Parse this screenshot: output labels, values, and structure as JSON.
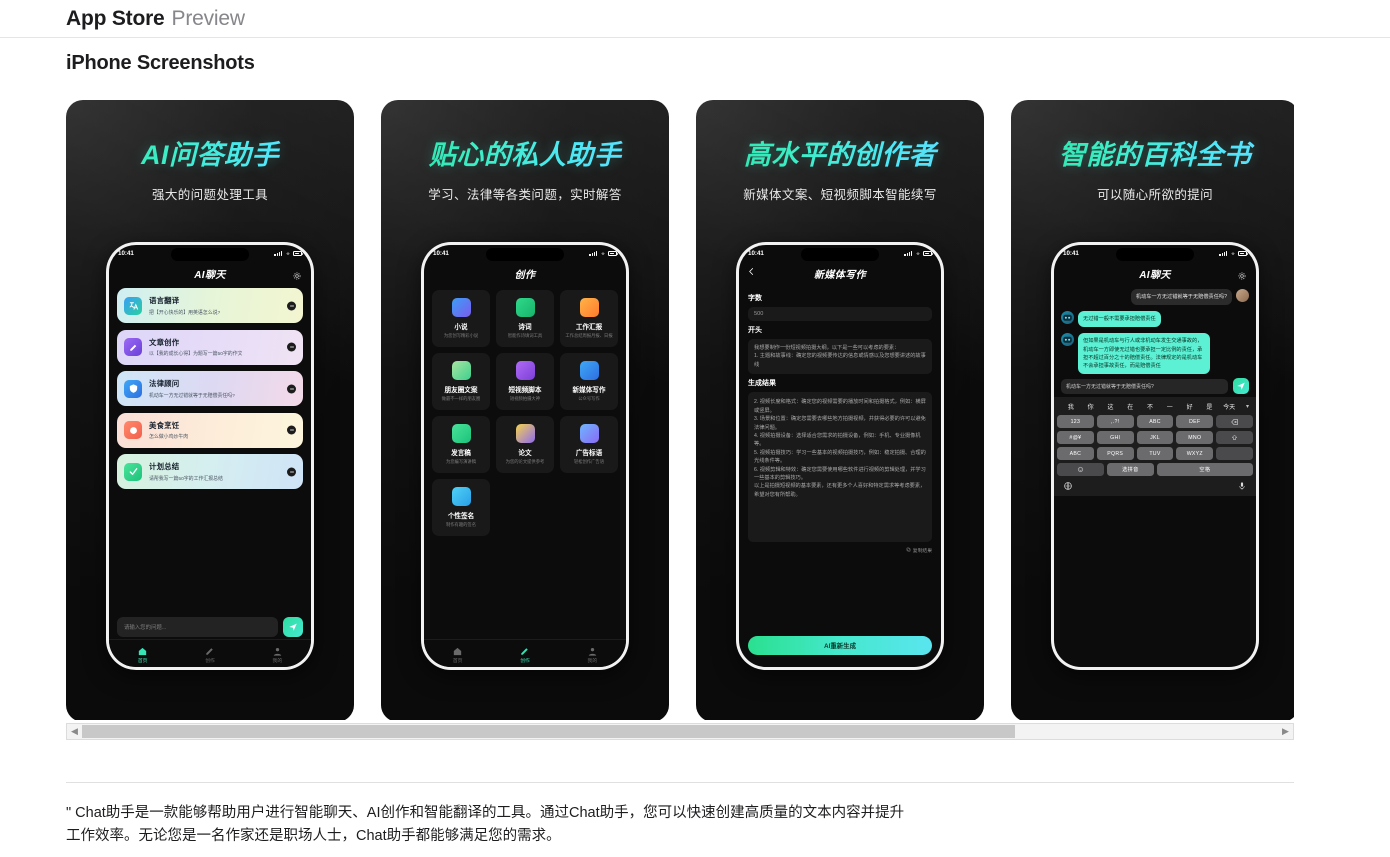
{
  "header": {
    "brand": "App Store",
    "preview": "Preview"
  },
  "section": {
    "title": "iPhone Screenshots"
  },
  "scrollbar": {
    "left_arrow": "◀",
    "right_arrow": "▶"
  },
  "description": "\" Chat助手是一款能够帮助用户进行智能聊天、AI创作和智能翻译的工具。通过Chat助手，您可以快速创建高质量的文本内容并提升工作效率。无论您是一名作家还是职场人士，Chat助手都能够满足您的需求。",
  "colors": {
    "accent_green": "#2fdd9f",
    "accent_cyan": "#5ae5ef",
    "bot_bubble": "#5cf0d5"
  },
  "shots": [
    {
      "title": "AI问答助手",
      "subtitle": "强大的问题处理工具",
      "phone": {
        "status_time": "10:41",
        "nav_title": "AI聊天",
        "nav_right_icon": "gear-icon",
        "cards": [
          {
            "title": "语言翻译",
            "sub": "把【开心快乐的】用英语怎么说?",
            "icon": "translate-icon",
            "bg": "linear-gradient(100deg,#cfeef2,#e6f5d8,#f3f5d0)"
          },
          {
            "title": "文章创作",
            "sub": "以【我的成长心得】为题写一篇50字的作文",
            "icon": "pencil-icon",
            "bg": "linear-gradient(100deg,#ddd6f7,#e6dcf8,#efe3f3)"
          },
          {
            "title": "法律顾问",
            "sub": "机动车一方无过错就等于无赔偿责任吗?",
            "icon": "law-icon",
            "bg": "linear-gradient(100deg,#cfe6f7,#ddd9f3,#f3d9e8)"
          },
          {
            "title": "美食烹饪",
            "sub": "怎么做小鸡炒牛肉",
            "icon": "food-icon",
            "bg": "linear-gradient(100deg,#fadfd6,#fdecd9,#fdf6dd)"
          },
          {
            "title": "计划总结",
            "sub": "请帮我写一篇50字的工作汇报总结",
            "icon": "check-icon",
            "bg": "linear-gradient(100deg,#d6f2de,#d5eef0,#cfe4f7)"
          }
        ],
        "input_placeholder": "请输入您的问题...",
        "send_icon": "send-icon",
        "tabs": [
          {
            "label": "首页",
            "icon": "home-icon",
            "active": true
          },
          {
            "label": "创作",
            "icon": "create-icon",
            "active": false
          },
          {
            "label": "我的",
            "icon": "user-icon",
            "active": false
          }
        ]
      }
    },
    {
      "title": "贴心的私人助手",
      "subtitle": "学习、法律等各类问题，实时解答",
      "phone": {
        "status_time": "10:41",
        "nav_title": "创作",
        "grid": [
          {
            "title": "小说",
            "sub": "为您创写精彩小说",
            "icon": "book-icon",
            "bg": "linear-gradient(135deg,#3b9ef5,#7b5cf0)"
          },
          {
            "title": "诗词",
            "sub": "智能作诗填词工具",
            "icon": "poem-icon",
            "bg": "linear-gradient(135deg,#2fd98a,#17b36a)"
          },
          {
            "title": "工作汇报",
            "sub": "工作总结周报月报、日报",
            "icon": "report-icon",
            "bg": "linear-gradient(135deg,#ffb347,#ff7b2e)"
          },
          {
            "title": "朋友圈文案",
            "sub": "做最不一样的朋友圈",
            "icon": "moments-icon",
            "bg": "linear-gradient(135deg,#a8e6a1,#3fcf8e)"
          },
          {
            "title": "短视频脚本",
            "sub": "短视频拍摄大神",
            "icon": "video-icon",
            "bg": "linear-gradient(135deg,#b06bf5,#7b3fd8)"
          },
          {
            "title": "新媒体写作",
            "sub": "公众号写作",
            "icon": "media-icon",
            "bg": "linear-gradient(135deg,#3fa8f5,#2e6ee0)"
          },
          {
            "title": "发言稿",
            "sub": "为您编写演讲稿",
            "icon": "speech-icon",
            "bg": "linear-gradient(135deg,#49e39a,#1cc27a)"
          },
          {
            "title": "论文",
            "sub": "为您的论文提供参考",
            "icon": "paper-icon",
            "bg": "linear-gradient(135deg,#f5d24b,#8e6bf0)"
          },
          {
            "title": "广告标语",
            "sub": "轻松创作广告语",
            "icon": "ad-icon",
            "bg": "linear-gradient(135deg,#6fb5ff,#8a6bf5)"
          },
          {
            "title": "个性签名",
            "sub": "制作有趣的签名",
            "icon": "sign-icon",
            "bg": "linear-gradient(135deg,#4fd2f5,#2a9fe8)"
          }
        ],
        "tabs": [
          {
            "label": "首页",
            "icon": "home-icon",
            "active": false
          },
          {
            "label": "创作",
            "icon": "create-icon",
            "active": true
          },
          {
            "label": "我的",
            "icon": "user-icon",
            "active": false
          }
        ]
      }
    },
    {
      "title": "高水平的创作者",
      "subtitle": "新媒体文案、短视频脚本智能续写",
      "phone": {
        "status_time": "10:41",
        "nav_title": "新媒体写作",
        "back_icon": "back-arrow-icon",
        "field_count_label": "字数",
        "field_count_value": "500",
        "field_start_label": "开头",
        "field_start_value": "我想要制作一份短视频拍摄大纲，以下是一些可以考虑的要素：\n1. 主题和故事线：确定您的视频要传达的信息或情感以及您想要讲述的故事线",
        "result_label": "生成结果",
        "result_text": "2. 视频长度和格式：确定您的视频需要的播放时间和拍摄格式，例如：横屏或竖屏。\n3. 场景和位置：确定您需要去哪些地方拍摄视频，并获得必要的许可以避免法律问题。\n4. 视频拍摄设备：选择适合您需求的拍摄设备，例如：手机、专业摄像机等。\n5. 视频拍摄技巧：学习一些基本的视频拍摄技巧，例如：稳定拍摄、合理的光线条件等。\n6. 视频剪辑和特效：确定您需要使用哪些软件进行视频的剪辑处理，并学习一些基本的剪辑技巧。\n以上是拍摄短视频的基本要素，还有更多个人喜好和特定需求等考虑要素，希望对您有所帮助。",
        "copy_label": "复制结果",
        "cta_label": "AI重新生成"
      }
    },
    {
      "title": "智能的百科全书",
      "subtitle": "可以随心所欲的提问",
      "phone": {
        "status_time": "10:41",
        "nav_title": "AI聊天",
        "nav_right_icon": "gear-icon",
        "messages": [
          {
            "from": "user",
            "text": "机动车一方无过错就等于无赔偿责任吗?"
          },
          {
            "from": "bot",
            "text": "无过错一般不需要承担赔偿责任"
          },
          {
            "from": "bot",
            "text": "但如果是机动车与行人或非机动车发生交通事故的，机动车一方即使无过错也要承担一定比例的责任，承担不超过百分之十的赔偿责任。法律规定的是机动车不会承担事故责任，而是赔偿责任"
          }
        ],
        "input_value": "机动车一方无过错就等于无赔偿责任吗?",
        "send_icon": "send-icon",
        "keyboard": {
          "suggestions": [
            "我",
            "你",
            "这",
            "在",
            "不",
            "一",
            "好",
            "是",
            "今天"
          ],
          "collapse_icon": "chevron-down-icon",
          "rows": [
            [
              "123",
              ",.?!",
              "ABC",
              "DEF",
              "backspace-icon"
            ],
            [
              "#@¥",
              "GHI",
              "JKL",
              "MNO",
              "shift-icon"
            ],
            [
              "ABC",
              "PQRS",
              "TUV",
              "WXYZ",
              "return-key"
            ],
            [
              "emoji-icon",
              "选拼音",
              "空格"
            ]
          ],
          "globe_icon": "globe-icon",
          "mic_icon": "microphone-icon"
        }
      }
    }
  ]
}
